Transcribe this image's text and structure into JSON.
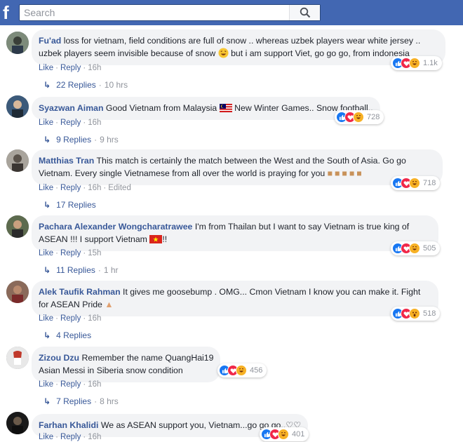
{
  "search": {
    "placeholder": "Search"
  },
  "colors": {
    "brand": "#4267b2",
    "link": "#385898",
    "muted": "#90949c",
    "bubble": "#f2f3f5"
  },
  "labels": {
    "like": "Like",
    "reply": "Reply",
    "edited": "Edited",
    "sep": "·"
  },
  "comments": [
    {
      "author": "Fu'ad",
      "text": "loss for vietnam, field conditions are full of snow .. whereas uzbek players wear white jersey ..",
      "text2": "uzbek players seem invisible because of snow",
      "text3": "but i am support Viet, go go go, from indonesia",
      "time": "16h",
      "reactions": "1.1k",
      "reaction_icons": [
        "like-icon",
        "love-icon",
        "haha-icon"
      ],
      "replies": "22 Replies",
      "replies_time": "10 hrs"
    },
    {
      "author": "Syazwan Aiman",
      "text": "Good Vietnam from Malaysia",
      "text2": "New Winter Games.. Snow football..",
      "time": "16h",
      "reactions": "728",
      "reaction_icons": [
        "like-icon",
        "love-icon",
        "haha-icon"
      ],
      "replies": "9 Replies",
      "replies_time": "9 hrs"
    },
    {
      "author": "Matthias Tran",
      "text": "This match is certainly the match between the West and the South of Asia. Go go",
      "text2": "Vietnam. Every single Vietnamese from all over the world is praying for you",
      "time": "16h",
      "reactions": "718",
      "reaction_icons": [
        "like-icon",
        "love-icon",
        "haha-icon"
      ],
      "replies": "17 Replies",
      "replies_time": ""
    },
    {
      "author": "Pachara Alexander Wongcharatrawee",
      "text": "I'm from Thailan but I want to say Vietnam is true king of",
      "text2": "ASEAN !!! I support Vietnam",
      "text3": "!!",
      "time": "15h",
      "reactions": "505",
      "reaction_icons": [
        "like-icon",
        "love-icon",
        "haha-icon"
      ],
      "replies": "11 Replies",
      "replies_time": "1 hr"
    },
    {
      "author": "Alek Taufik Rahman",
      "text": "It gives me goosebump . OMG... Cmon Vietnam I know you can make it. Fight",
      "text2": "for ASEAN Pride",
      "time": "16h",
      "reactions": "518",
      "reaction_icons": [
        "like-icon",
        "love-icon",
        "wow-icon"
      ],
      "replies": "4 Replies",
      "replies_time": ""
    },
    {
      "author": "Zizou Dzu",
      "text": "Remember the name QuangHai19",
      "text2": "Asian Messi in Siberia snow condition",
      "time": "16h",
      "reactions": "456",
      "reaction_icons": [
        "like-icon",
        "love-icon",
        "haha-icon"
      ],
      "replies": "7 Replies",
      "replies_time": "8 hrs"
    },
    {
      "author": "Farhan Khalidi",
      "text": "We as ASEAN support you, Vietnam...go go go..♡♡",
      "time": "16h",
      "reactions": "401",
      "reaction_icons": [
        "like-icon",
        "love-icon",
        "haha-icon"
      ]
    }
  ]
}
